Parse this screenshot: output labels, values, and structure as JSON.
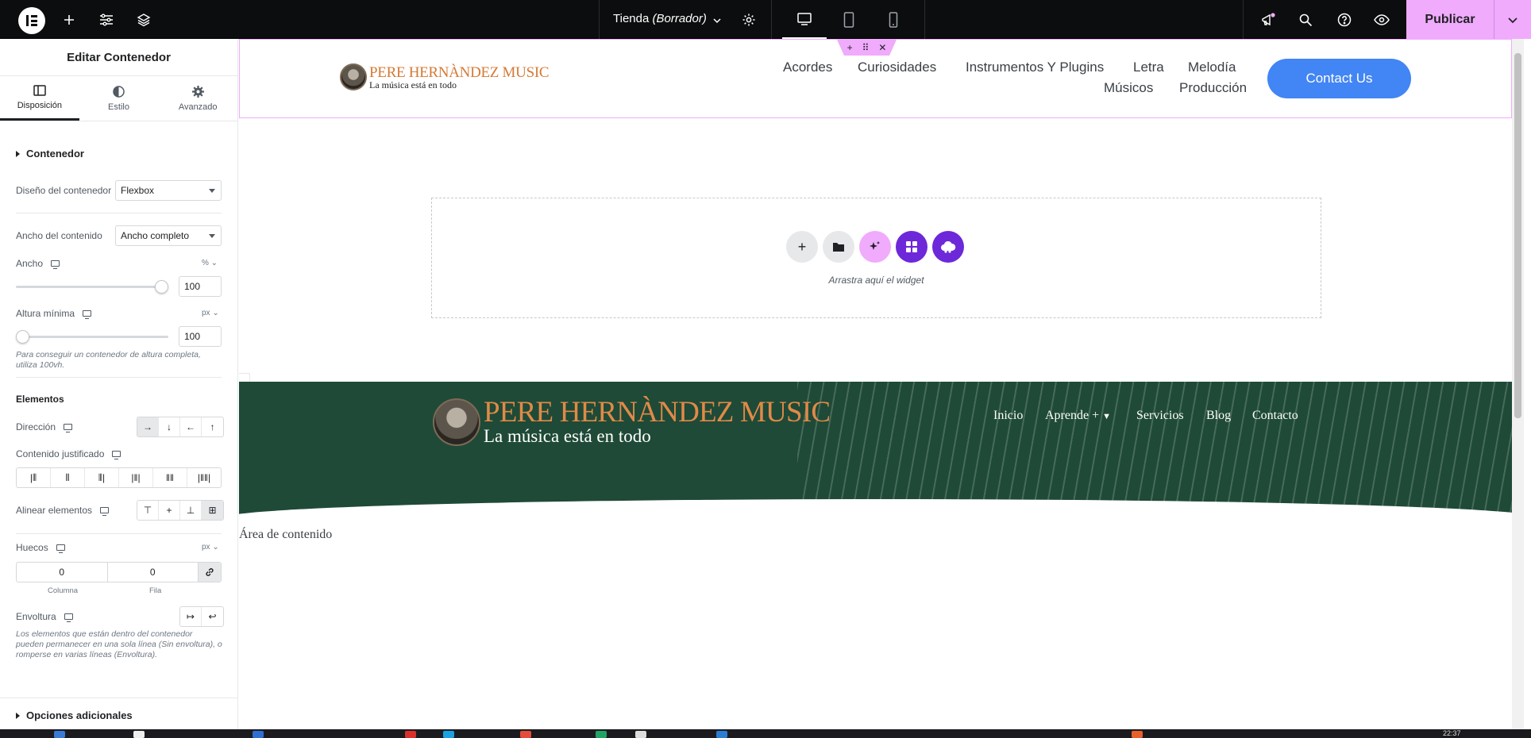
{
  "topbar": {
    "document_name": "Tienda",
    "document_status": "(Borrador)",
    "publish_label": "Publicar"
  },
  "panel": {
    "header_title": "Editar Contenedor",
    "tabs": [
      {
        "label": "Disposición"
      },
      {
        "label": "Estilo"
      },
      {
        "label": "Avanzado"
      }
    ],
    "section_container": "Contenedor",
    "container_layout_label": "Diseño del contenedor",
    "container_layout_value": "Flexbox",
    "content_width_label": "Ancho del contenido",
    "content_width_value": "Ancho completo",
    "width_label": "Ancho",
    "width_unit": "%",
    "width_value": "100",
    "width_slider_fraction": 1.0,
    "min_height_label": "Altura mínima",
    "min_height_unit": "px",
    "min_height_value": "100",
    "min_height_slider_fraction": 0.0,
    "min_height_help": "Para conseguir un contenedor de altura completa, utiliza 100vh.",
    "elements_title": "Elementos",
    "direction_label": "Dirección",
    "justify_label": "Contenido justificado",
    "align_label": "Alinear elementos",
    "gaps_label": "Huecos",
    "gaps_unit": "px",
    "gap_column_value": "0",
    "gap_row_value": "0",
    "gap_column_label": "Columna",
    "gap_row_label": "Fila",
    "wrap_label": "Envoltura",
    "wrap_help": "Los elementos que están dentro del contenedor pueden permanecer en una sola línea (Sin envoltura), o romperse en varias líneas (Envoltura).",
    "additional_options": "Opciones adicionales"
  },
  "canvas": {
    "logo_title": "PERE HERNÀNDEZ MUSIC",
    "logo_tagline": "La música está en todo",
    "nav_items": [
      "Acordes",
      "Curiosidades",
      "Instrumentos Y Plugins",
      "Letra",
      "Melodía",
      "Músicos",
      "Producción"
    ],
    "contact_button": "Contact Us",
    "drop_zone_text": "Arrastra aquí el widget",
    "footer_nav": [
      "Inicio",
      "Aprende +",
      "Servicios",
      "Blog",
      "Contacto"
    ],
    "content_area_text": "Área de contenido"
  },
  "taskbar": {
    "clock": "22:37"
  },
  "colors": {
    "accent_pink": "#f0abfc",
    "topbar_bg": "#0c0d0e",
    "contact_blue": "#4285f4",
    "footer_green": "#1f4a37",
    "logo_orange": "#d47a35",
    "purple_button": "#6d28d9"
  }
}
